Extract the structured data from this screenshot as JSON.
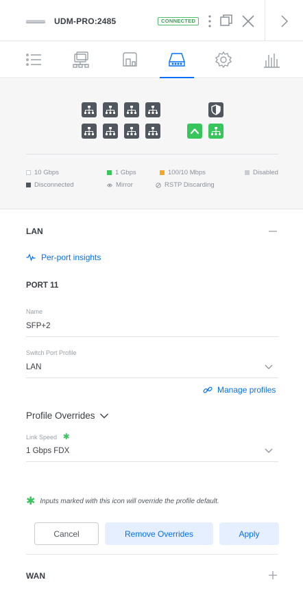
{
  "header": {
    "device_name": "UDM-PRO:2485",
    "status_badge": "CONNECTED",
    "icons": [
      "device-thumbnail-icon",
      "kebab-menu-icon",
      "detach-window-icon",
      "close-icon",
      "chevron-right-icon"
    ]
  },
  "tabs": [
    {
      "name": "overview",
      "icon": "list-icon"
    },
    {
      "name": "topology",
      "icon": "network-topology-icon"
    },
    {
      "name": "devices",
      "icon": "devices-icon"
    },
    {
      "name": "ports",
      "icon": "switch-ports-icon",
      "active": true
    },
    {
      "name": "settings",
      "icon": "gear-icon"
    },
    {
      "name": "statistics",
      "icon": "bar-chart-icon"
    }
  ],
  "ports": {
    "top_row": [
      "disconnected",
      "disconnected",
      "disconnected",
      "disconnected"
    ],
    "bottom_row": [
      "disconnected",
      "disconnected",
      "disconnected",
      "disconnected"
    ],
    "extra": [
      {
        "name": "wan-shield-port",
        "state": "disconnected",
        "icon": "shield-icon"
      },
      {
        "name": "uplink-port",
        "state": "1gbps",
        "icon": "up-arrow-icon"
      },
      {
        "name": "sfp-port",
        "state": "1gbps",
        "icon": "network-icon"
      }
    ],
    "legend": {
      "gbps10": "10 Gbps",
      "gbps1": "1 Gbps",
      "mbps100": "100/10 Mbps",
      "disabled": "Disabled",
      "disconnected": "Disconnected",
      "mirror": "Mirror",
      "rstp": "RSTP Discarding"
    },
    "colors": {
      "gbps10": "#ffffff",
      "gbps1": "#38c55c",
      "mbps100": "#f5a623",
      "disabled": "#c8ccd1",
      "disconnected": "#50565e"
    }
  },
  "lan": {
    "title": "LAN",
    "insights_link": "Per-port insights",
    "port_title": "PORT 11",
    "name_label": "Name",
    "name_value": "SFP+2",
    "profile_label": "Switch Port Profile",
    "profile_value": "LAN",
    "manage_link": "Manage profiles",
    "overrides_title": "Profile Overrides",
    "link_speed_label": "Link Speed",
    "override_marker": "✱",
    "link_speed_value": "1 Gbps FDX",
    "note": "Inputs marked with this icon will override the profile default."
  },
  "buttons": {
    "cancel": "Cancel",
    "remove": "Remove Overrides",
    "apply": "Apply"
  },
  "wan": {
    "title": "WAN"
  },
  "accent": "#006fff"
}
